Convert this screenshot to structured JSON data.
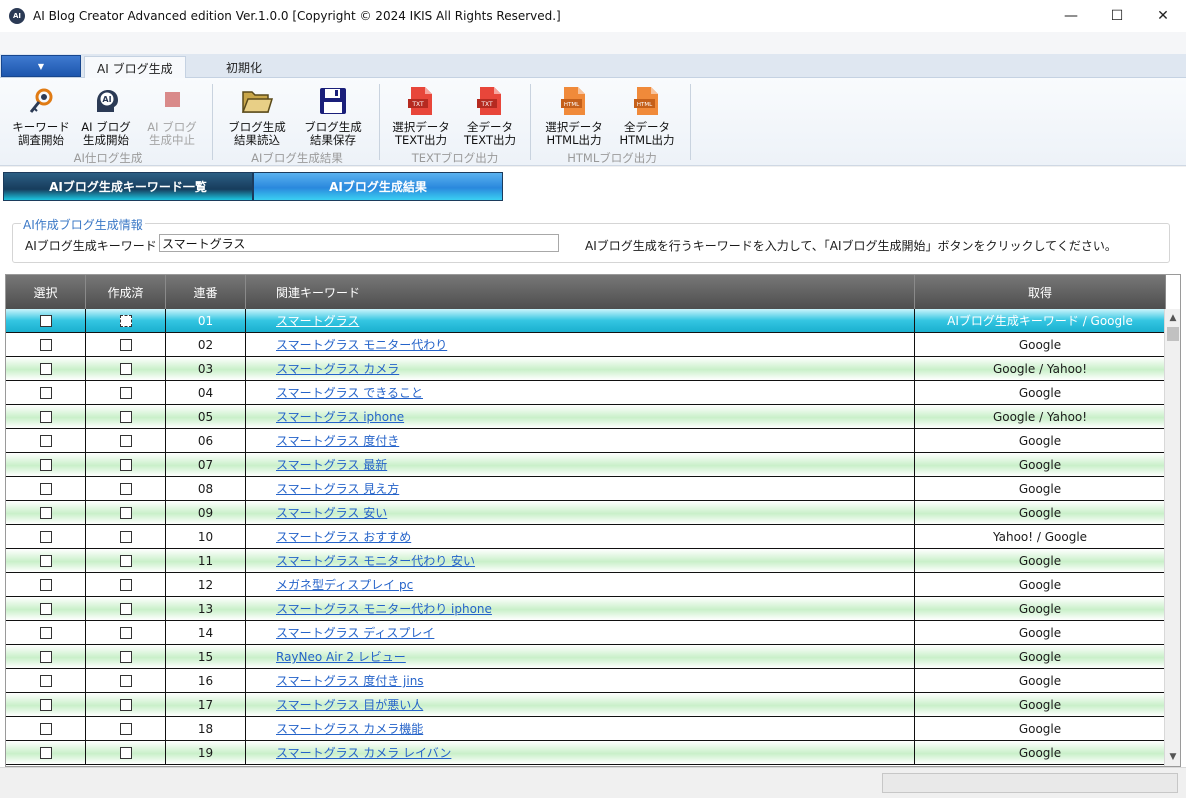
{
  "window": {
    "title": "AI Blog Creator Advanced edition Ver.1.0.0  [Copyright © 2024 IKIS All Rights Reserved.]",
    "minimize_glyph": "—",
    "maximize_glyph": "☐",
    "close_glyph": "✕"
  },
  "ribbon": {
    "file_menu_glyph": "▼",
    "tabs": [
      "AI ブログ生成",
      "初期化"
    ],
    "buttons": [
      {
        "line1": "キーワード",
        "line2": "調査開始",
        "icon": "key-search-icon",
        "enabled": true
      },
      {
        "line1": "AI ブログ",
        "line2": "生成開始",
        "icon": "ai-head-icon",
        "enabled": true
      },
      {
        "line1": "AI ブログ",
        "line2": "生成中止",
        "icon": "stop-icon",
        "enabled": false
      },
      {
        "line1": "ブログ生成",
        "line2": "結果読込",
        "icon": "folder-open-icon",
        "enabled": true
      },
      {
        "line1": "ブログ生成",
        "line2": "結果保存",
        "icon": "floppy-disk-icon",
        "enabled": true
      },
      {
        "line1": "選択データ",
        "line2": "TEXT出力",
        "icon": "txt-file-icon",
        "enabled": true
      },
      {
        "line1": "全データ",
        "line2": "TEXT出力",
        "icon": "txt-file-icon",
        "enabled": true
      },
      {
        "line1": "選択データ",
        "line2": "HTML出力",
        "icon": "html-file-icon",
        "enabled": true
      },
      {
        "line1": "全データ",
        "line2": "HTML出力",
        "icon": "html-file-icon",
        "enabled": true
      }
    ],
    "groups": [
      "AI仕ログ生成",
      "AIブログ生成結果",
      "TEXTブログ出力",
      "HTMLブログ出力"
    ]
  },
  "main_tabs": [
    "AIブログ生成キーワード一覧",
    "AIブログ生成結果"
  ],
  "info": {
    "legend": "AI作成ブログ生成情報",
    "keyword_label": "AIブログ生成キーワード",
    "keyword_value": "スマートグラス",
    "hint": "AIブログ生成を行うキーワードを入力して、「AIブログ生成開始」ボタンをクリックしてください。"
  },
  "table": {
    "headers": [
      "選択",
      "作成済",
      "連番",
      "関連キーワード",
      "取得"
    ],
    "rows": [
      {
        "no": "01",
        "keyword": "スマートグラス",
        "source": "AIブログ生成キーワード / Google"
      },
      {
        "no": "02",
        "keyword": "スマートグラス モニター代わり",
        "source": "Google"
      },
      {
        "no": "03",
        "keyword": "スマートグラス カメラ",
        "source": "Google / Yahoo!"
      },
      {
        "no": "04",
        "keyword": "スマートグラス できること",
        "source": "Google"
      },
      {
        "no": "05",
        "keyword": "スマートグラス iphone",
        "source": "Google / Yahoo!"
      },
      {
        "no": "06",
        "keyword": "スマートグラス 度付き",
        "source": "Google"
      },
      {
        "no": "07",
        "keyword": "スマートグラス 最新",
        "source": "Google"
      },
      {
        "no": "08",
        "keyword": "スマートグラス 見え方",
        "source": "Google"
      },
      {
        "no": "09",
        "keyword": "スマートグラス 安い",
        "source": "Google"
      },
      {
        "no": "10",
        "keyword": "スマートグラス おすすめ",
        "source": "Yahoo! / Google"
      },
      {
        "no": "11",
        "keyword": "スマートグラス モニター代わり 安い",
        "source": "Google"
      },
      {
        "no": "12",
        "keyword": "メガネ型ディスプレイ pc",
        "source": "Google"
      },
      {
        "no": "13",
        "keyword": "スマートグラス モニター代わり iphone",
        "source": "Google"
      },
      {
        "no": "14",
        "keyword": "スマートグラス ディスプレイ",
        "source": "Google"
      },
      {
        "no": "15",
        "keyword": "RayNeo Air 2 レビュー",
        "source": "Google"
      },
      {
        "no": "16",
        "keyword": "スマートグラス 度付き jins",
        "source": "Google"
      },
      {
        "no": "17",
        "keyword": "スマートグラス 目が悪い人",
        "source": "Google"
      },
      {
        "no": "18",
        "keyword": "スマートグラス カメラ機能",
        "source": "Google"
      },
      {
        "no": "19",
        "keyword": "スマートグラス カメラ レイバン",
        "source": "Google"
      }
    ]
  },
  "colors": {
    "selected_row": "#1ab0cf",
    "alt_row": "#c9f0c9",
    "link": "#2563c9"
  }
}
